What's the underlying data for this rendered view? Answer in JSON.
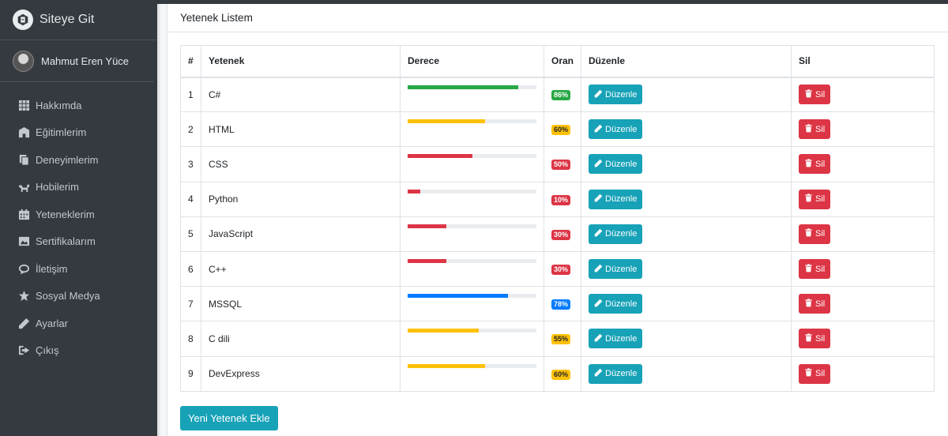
{
  "brand": {
    "title": "Siteye Git"
  },
  "user": {
    "name": "Mahmut Eren Yüce"
  },
  "sidebar": {
    "items": [
      {
        "label": "Hakkımda",
        "icon": "grid-icon"
      },
      {
        "label": "Eğitimlerim",
        "icon": "school-icon"
      },
      {
        "label": "Deneyimlerim",
        "icon": "copy-icon"
      },
      {
        "label": "Hobilerim",
        "icon": "dog-icon"
      },
      {
        "label": "Yeteneklerim",
        "icon": "calendar-icon"
      },
      {
        "label": "Sertifikalarım",
        "icon": "image-icon"
      },
      {
        "label": "İletişim",
        "icon": "comment-icon"
      },
      {
        "label": "Sosyal Medya",
        "icon": "star-icon"
      },
      {
        "label": "Ayarlar",
        "icon": "pencil-icon"
      },
      {
        "label": "Çıkış",
        "icon": "sign-out-icon"
      }
    ]
  },
  "card": {
    "title": "Yetenek Listem"
  },
  "table": {
    "headers": [
      "#",
      "Yetenek",
      "Derece",
      "Oran",
      "Düzenle",
      "Sil"
    ],
    "edit_label": "Düzenle",
    "delete_label": "Sil",
    "rows": [
      {
        "num": "1",
        "skill": "C#",
        "percent": 86,
        "percent_label": "86%",
        "color": "#28a745"
      },
      {
        "num": "2",
        "skill": "HTML",
        "percent": 60,
        "percent_label": "60%",
        "color": "#ffc107"
      },
      {
        "num": "3",
        "skill": "CSS",
        "percent": 50,
        "percent_label": "50%",
        "color": "#dc3545"
      },
      {
        "num": "4",
        "skill": "Python",
        "percent": 10,
        "percent_label": "10%",
        "color": "#dc3545"
      },
      {
        "num": "5",
        "skill": "JavaScript",
        "percent": 30,
        "percent_label": "30%",
        "color": "#dc3545"
      },
      {
        "num": "6",
        "skill": "C++",
        "percent": 30,
        "percent_label": "30%",
        "color": "#dc3545"
      },
      {
        "num": "7",
        "skill": "MSSQL",
        "percent": 78,
        "percent_label": "78%",
        "color": "#007bff"
      },
      {
        "num": "8",
        "skill": "C dili",
        "percent": 55,
        "percent_label": "55%",
        "color": "#ffc107"
      },
      {
        "num": "9",
        "skill": "DevExpress",
        "percent": 60,
        "percent_label": "60%",
        "color": "#ffc107"
      }
    ]
  },
  "add_button": {
    "label": "Yeni Yetenek Ekle"
  }
}
